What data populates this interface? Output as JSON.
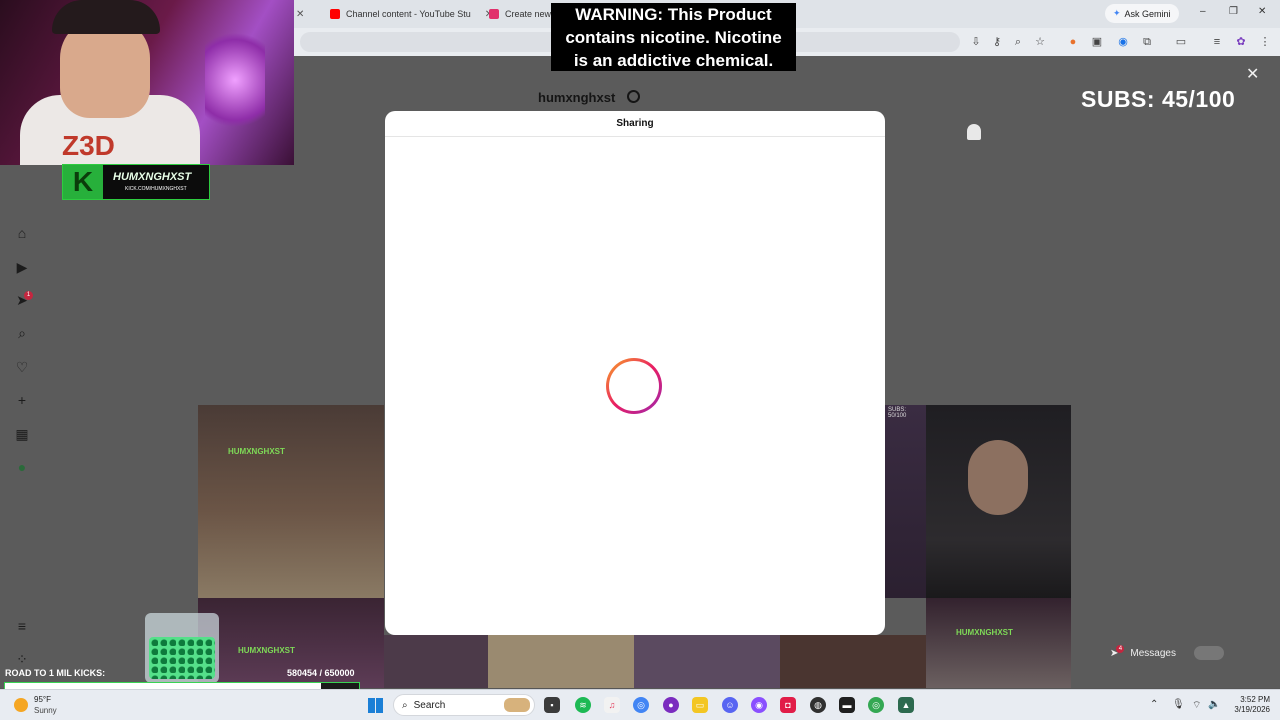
{
  "browser": {
    "tabs": [
      {
        "label": "Channel content - YouTube Stu",
        "icon": "youtube-icon",
        "color": "#ff0000"
      },
      {
        "label": "Create new p",
        "icon": "instagram-icon",
        "color": "#e1306c"
      }
    ],
    "gemini_label": "Ask Gemini"
  },
  "instagram": {
    "profile_name": "humxnghxst",
    "modal_title": "Sharing",
    "messages_label": "Messages",
    "messages_badge": "4",
    "notification_badge": "1",
    "overlay_tile_text": "SUBS: 50/100"
  },
  "stream_overlay": {
    "warning_line1": "WARNING: This Product",
    "warning_line2": "contains nicotine. Nicotine",
    "warning_line3": "is an addictive chemical.",
    "subs_counter": "SUBS: 45/100",
    "kick_name": "HUMXNGHXST",
    "kick_url": "KICK.COM/HUMXNGHXST",
    "road_label": "ROAD TO 1 MIL KICKS:",
    "road_value": "580454  / 650000",
    "road_progress": 0.893,
    "shirt_text": "Z3D"
  },
  "taskbar": {
    "weather_temp": "95°F",
    "weather_desc": "Sunny",
    "search_placeholder": "Search",
    "time": "3:52 PM",
    "date": "3/19/2026"
  },
  "colors": {
    "accent_green": "#39d353",
    "spinner_start": "#f9a825",
    "spinner_mid": "#e91e63",
    "spinner_end": "#9c27b0"
  }
}
